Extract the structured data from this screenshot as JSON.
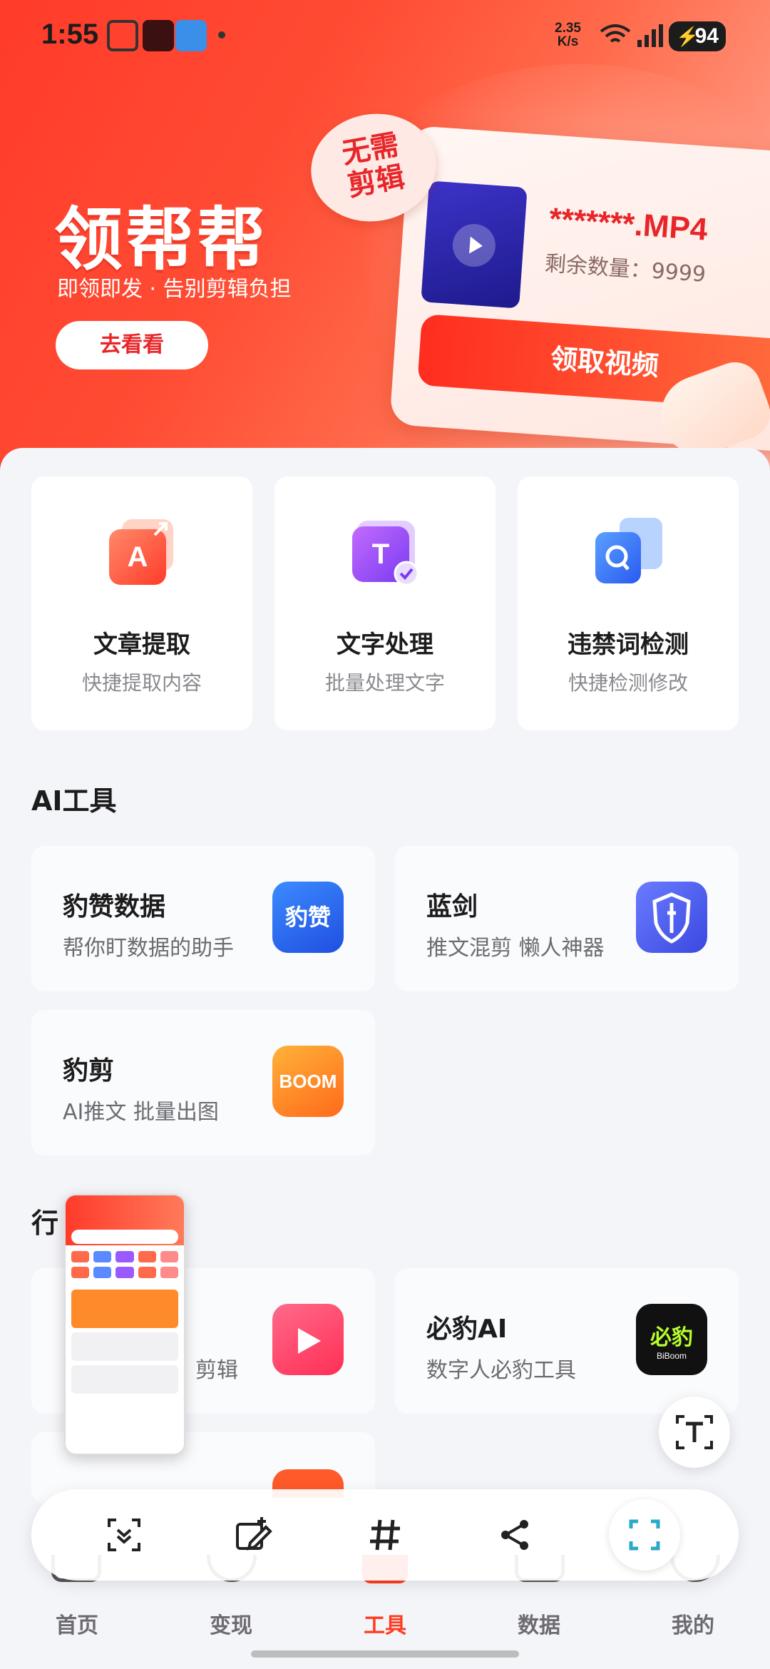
{
  "status_bar": {
    "time": "1:55",
    "net_speed_value": "2.35",
    "net_speed_unit": "K/s",
    "battery": "94"
  },
  "hero": {
    "title": "领帮帮",
    "subtitle": "即领即发 · 告别剪辑负担",
    "button_label": "去看看",
    "stamp_text": "无需\n剪辑",
    "file_name": "*******.MP4",
    "remaining": "剩余数量：9999",
    "claim_button": "领取视频"
  },
  "features": [
    {
      "title": "文章提取",
      "subtitle": "快捷提取内容",
      "icon": "article-extract-icon"
    },
    {
      "title": "文字处理",
      "subtitle": "批量处理文字",
      "icon": "text-process-icon"
    },
    {
      "title": "违禁词检测",
      "subtitle": "快捷检测修改",
      "icon": "banned-word-check-icon"
    }
  ],
  "ai_tools": {
    "section_title": "AI工具",
    "items": [
      {
        "name": "豹赞数据",
        "desc": "帮你盯数据的助手",
        "icon_text": "豹赞",
        "color": "#2f6bff"
      },
      {
        "name": "蓝剑",
        "desc": "推文混剪 懒人神器",
        "icon_text": "",
        "color": "#4a5cf0"
      },
      {
        "name": "豹剪",
        "desc": "AI推文 批量出图",
        "icon_text": "BOOM",
        "color": "#ff7a1a"
      }
    ]
  },
  "industry": {
    "section_title_partial": "行",
    "items": [
      {
        "name": "",
        "desc": "剪辑",
        "color": "#ff3b5a"
      },
      {
        "name": "必豹AI",
        "desc": "数字人必豹工具",
        "icon_text": "必豹",
        "icon_sub": "BiBoom",
        "color": "#111111"
      }
    ]
  },
  "toolbar": {
    "items": [
      "scroll-capture-icon",
      "edit-capture-icon",
      "hashtag-icon",
      "share-icon",
      "scan-icon"
    ]
  },
  "bottom_nav": {
    "items": [
      {
        "label": "首页"
      },
      {
        "label": "变现"
      },
      {
        "label": "工具"
      },
      {
        "label": "数据"
      },
      {
        "label": "我的"
      }
    ],
    "active_index": 2
  }
}
